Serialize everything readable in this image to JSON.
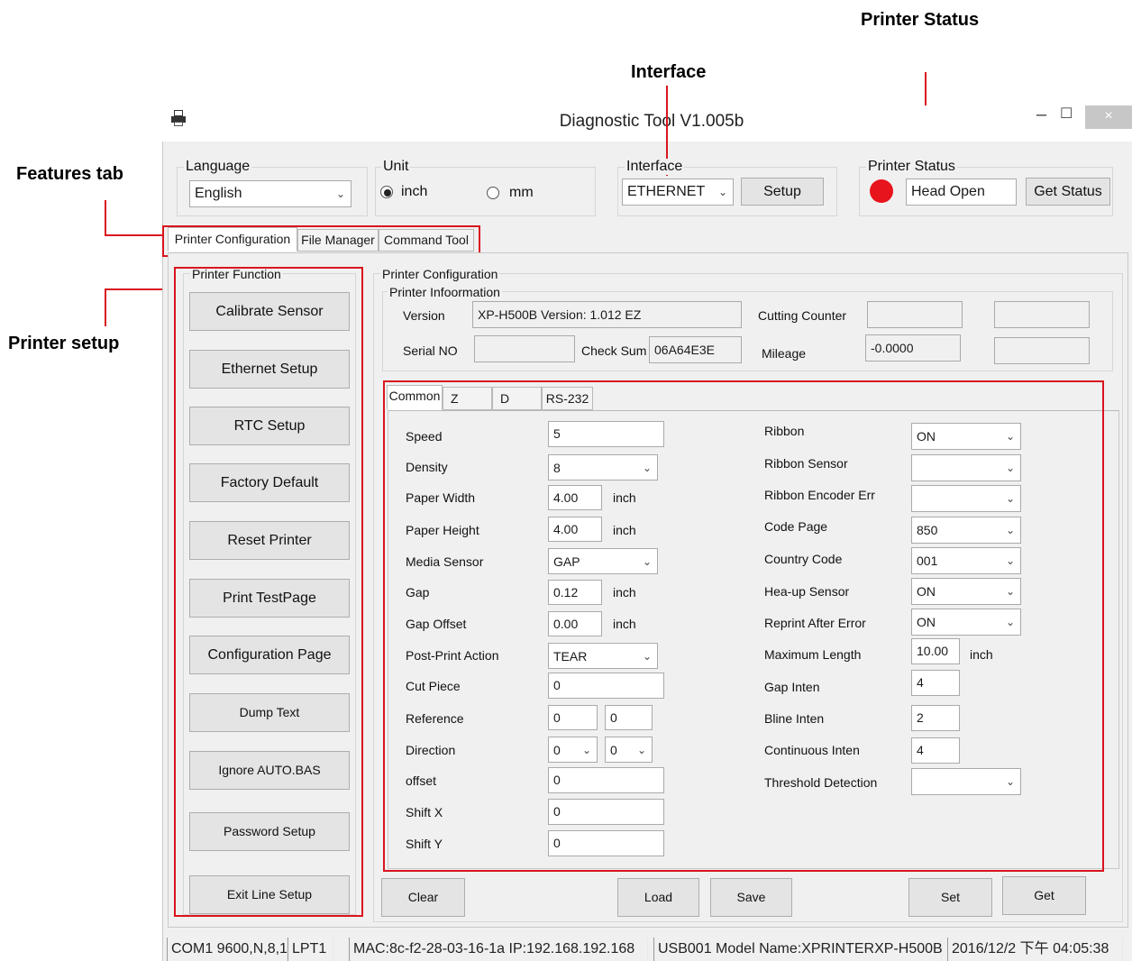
{
  "callouts": {
    "printer_status": "Printer Status",
    "interface": "Interface",
    "features_tab": "Features tab",
    "printer_setup": "Printer setup"
  },
  "window": {
    "title": "Diagnostic Tool V1.005b",
    "close_glyph": "×",
    "minimize_glyph": "–",
    "maximize_glyph": "☐"
  },
  "language": {
    "label": "Language",
    "value": "English"
  },
  "unit": {
    "label": "Unit",
    "options": [
      "inch",
      "mm"
    ],
    "selected": "inch"
  },
  "interface": {
    "label": "Interface",
    "value": "ETHERNET",
    "setup_label": "Setup"
  },
  "printer_status": {
    "label": "Printer  Status",
    "value": "Head Open",
    "get_label": "Get Status",
    "indicator_color": "#e8141c"
  },
  "tabs": [
    "Printer Configuration",
    "File Manager",
    "Command Tool"
  ],
  "printer_function": {
    "label": "Printer  Function",
    "buttons": [
      "Calibrate Sensor",
      "Ethernet Setup",
      "RTC Setup",
      "Factory Default",
      "Reset Printer",
      "Print TestPage",
      "Configuration Page",
      "Dump Text",
      "Ignore AUTO.BAS",
      "Password Setup",
      "Exit Line Setup"
    ]
  },
  "config": {
    "label": "Printer Configuration",
    "info_label": "Printer Infoormation",
    "version_label": "Version",
    "version_value": "XP-H500B Version: 1.012 EZ",
    "serial_label": "Serial NO",
    "serial_value": "",
    "checksum_label": "Check Sum",
    "checksum_value": "06A64E3E",
    "cutting_label": "Cutting Counter",
    "cutting_value": "",
    "mileage_label": "Mileage",
    "mileage_value": "-0.0000"
  },
  "subtabs": [
    "Common",
    "Z",
    "D",
    "RS-232"
  ],
  "left_settings": [
    {
      "label": "Speed",
      "value": "5"
    },
    {
      "label": "Density",
      "value": "8"
    },
    {
      "label": "Paper Width",
      "value": "4.00",
      "unit": "inch"
    },
    {
      "label": "Paper Height",
      "value": "4.00",
      "unit": "inch"
    },
    {
      "label": "Media Sensor",
      "value": "GAP"
    },
    {
      "label": "Gap",
      "value": "0.12",
      "unit": "inch"
    },
    {
      "label": "Gap Offset",
      "value": "0.00",
      "unit": "inch"
    },
    {
      "label": "Post-Print  Action",
      "value": "TEAR"
    },
    {
      "label": "Cut  Piece",
      "value": "0"
    },
    {
      "label": "Reference",
      "value": "0",
      "value2": "0"
    },
    {
      "label": "Direction",
      "value": "0",
      "value2": "0"
    },
    {
      "label": "offset",
      "value": "0"
    },
    {
      "label": "Shift X",
      "value": "0"
    },
    {
      "label": "Shift Y",
      "value": "0"
    }
  ],
  "right_settings": [
    {
      "label": "Ribbon",
      "value": "ON"
    },
    {
      "label": "Ribbon  Sensor",
      "value": ""
    },
    {
      "label": "Ribbon Encoder Err",
      "value": ""
    },
    {
      "label": "Code Page",
      "value": "850"
    },
    {
      "label": "Country Code",
      "value": "001"
    },
    {
      "label": "Hea-up  Sensor",
      "value": "ON"
    },
    {
      "label": "Reprint After  Error",
      "value": "ON"
    },
    {
      "label": "Maximum Length",
      "value": "10.00",
      "unit": "inch"
    },
    {
      "label": "Gap Inten",
      "value": "4"
    },
    {
      "label": "Bline  Inten",
      "value": "2"
    },
    {
      "label": "Continuous  Inten",
      "value": "4"
    },
    {
      "label": "Threshold  Detection",
      "value": ""
    }
  ],
  "actions": {
    "clear": "Clear",
    "load": "Load",
    "save": "Save",
    "set": "Set",
    "get": "Get"
  },
  "statusbar": [
    "COM1 9600,N,8,1",
    "LPT1",
    "MAC:8c-f2-28-03-16-1a  IP:192.168.192.168",
    "USB001  Model Name:XPRINTERXP-H500B",
    "2016/12/2 下午 04:05:38"
  ],
  "colors": {
    "callout_red": "#d9141e"
  }
}
